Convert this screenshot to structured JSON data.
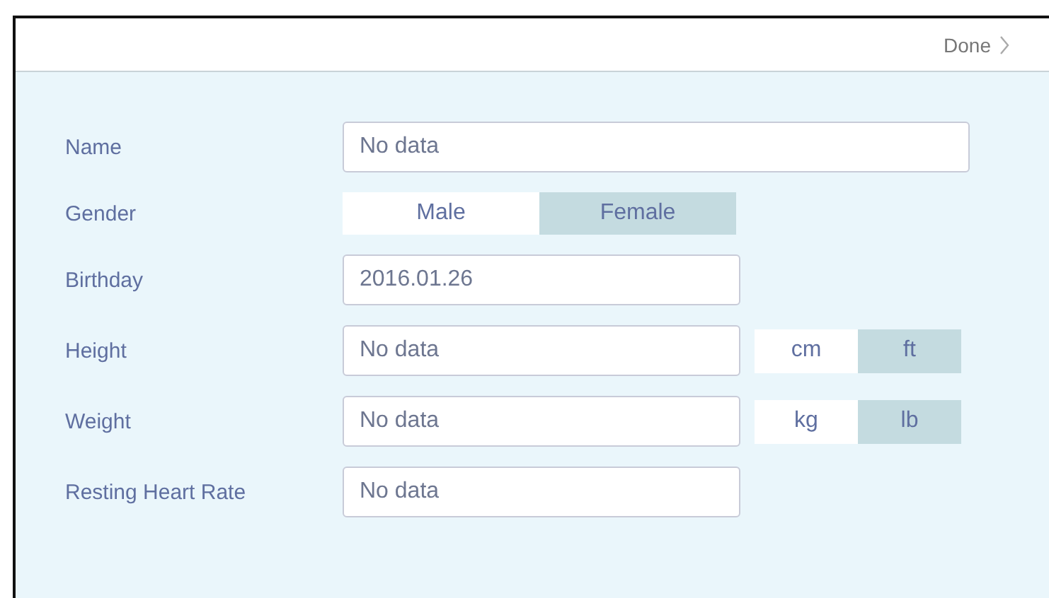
{
  "header": {
    "done_label": "Done"
  },
  "fields": [
    {
      "kind": "text",
      "label": "Name",
      "value": "No data",
      "wide": true
    },
    {
      "kind": "toggle",
      "label": "Gender",
      "options": [
        {
          "label": "Male",
          "selected": false
        },
        {
          "label": "Female",
          "selected": true
        }
      ]
    },
    {
      "kind": "text",
      "label": "Birthday",
      "value": "2016.01.26"
    },
    {
      "kind": "text",
      "label": "Height",
      "value": "No data",
      "units": [
        {
          "label": "cm",
          "selected": false
        },
        {
          "label": "ft",
          "selected": true
        }
      ]
    },
    {
      "kind": "text",
      "label": "Weight",
      "value": "No data",
      "units": [
        {
          "label": "kg",
          "selected": false
        },
        {
          "label": "lb",
          "selected": true
        }
      ]
    },
    {
      "kind": "text",
      "label": "Resting Heart Rate",
      "value": "No data"
    }
  ]
}
